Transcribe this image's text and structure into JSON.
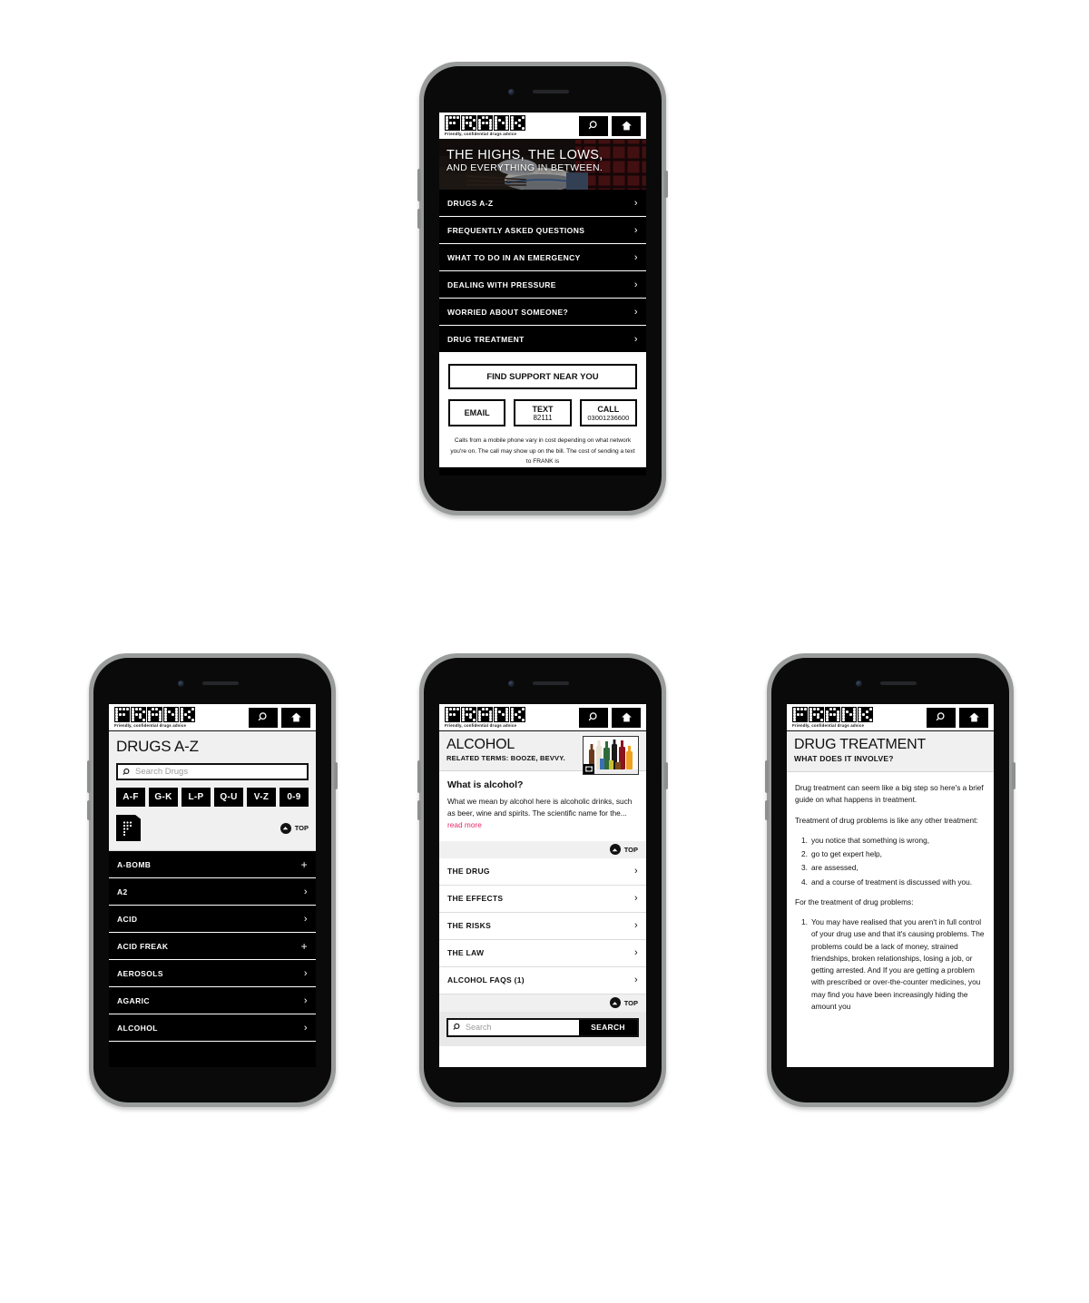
{
  "brand": {
    "name": "FRANK",
    "tagline": "Friendly, confidential drugs advice",
    "accent_pink": "#e8286e",
    "black": "#000000",
    "band_grey": "#f0f0f0"
  },
  "header": {
    "search_icon": "search-icon",
    "home_icon": "home-icon"
  },
  "phone_home": {
    "hero": {
      "line1": "THE HIGHS, THE LOWS,",
      "line2": "AND EVERYTHING IN BETWEEN."
    },
    "nav": [
      {
        "label": "DRUGS A-Z",
        "chevron": "›"
      },
      {
        "label": "FREQUENTLY ASKED QUESTIONS",
        "chevron": "›"
      },
      {
        "label": "WHAT TO DO IN AN EMERGENCY",
        "chevron": "›"
      },
      {
        "label": "DEALING WITH PRESSURE",
        "chevron": "›"
      },
      {
        "label": "WORRIED ABOUT SOMEONE?",
        "chevron": "›"
      },
      {
        "label": "DRUG TREATMENT",
        "chevron": "›"
      }
    ],
    "cta": {
      "find_support": "FIND SUPPORT NEAR YOU",
      "email": {
        "label": "EMAIL",
        "value": ""
      },
      "text": {
        "label": "TEXT",
        "value": "82111"
      },
      "call": {
        "label": "CALL",
        "value": "03001236600"
      },
      "note": "Calls from a mobile phone vary in cost depending on what network you're on. The call may show up on the bill. The cost of sending a text to FRANK is"
    }
  },
  "phone_az": {
    "title": "DRUGS A-Z",
    "search": {
      "placeholder": "Search Drugs",
      "value": ""
    },
    "chips": [
      "A-F",
      "G-K",
      "L-P",
      "Q-U",
      "V-Z",
      "0-9"
    ],
    "brand_tile": "frank-f-tile-icon",
    "top_label": "TOP",
    "drugs": [
      {
        "name": "A-BOMB",
        "marker": "+"
      },
      {
        "name": "A2",
        "marker": "›"
      },
      {
        "name": "ACID",
        "marker": "›"
      },
      {
        "name": "ACID FREAK",
        "marker": "+"
      },
      {
        "name": "AEROSOLS",
        "marker": "›"
      },
      {
        "name": "AGARIC",
        "marker": "›"
      },
      {
        "name": "ALCOHOL",
        "marker": "›"
      }
    ]
  },
  "phone_alcohol": {
    "title": "ALCOHOL",
    "subtitle": "RELATED TERMS: BOOZE, BEVVY.",
    "thumb_alt": "alcohol-bottles-thumbnail",
    "article": {
      "heading": "What is alcohol?",
      "body": "What we mean by alcohol here is alcoholic drinks, such as beer, wine and spirits. The scientific name for the...",
      "read_more": "read more"
    },
    "top_label": "TOP",
    "sections": [
      {
        "label": "THE DRUG",
        "chevron": "›"
      },
      {
        "label": "THE EFFECTS",
        "chevron": "›"
      },
      {
        "label": "THE RISKS",
        "chevron": "›"
      },
      {
        "label": "THE LAW",
        "chevron": "›"
      },
      {
        "label": "ALCOHOL FAQS (1)",
        "chevron": "›"
      }
    ],
    "search": {
      "placeholder": "Search",
      "value": "",
      "button": "SEARCH"
    }
  },
  "phone_treatment": {
    "title": "DRUG TREATMENT",
    "subtitle": "WHAT DOES IT INVOLVE?",
    "para1": "Drug treatment can seem like a big step so here's a brief guide on what happens in treatment.",
    "para2": "Treatment of drug problems is like any other treatment:",
    "list1": [
      {
        "num": "1.",
        "text": "you notice that something is wrong,"
      },
      {
        "num": "2.",
        "text": "go to get expert help,"
      },
      {
        "num": "3.",
        "text": "are assessed,"
      },
      {
        "num": "4.",
        "text": "and a course of treatment is discussed with you."
      }
    ],
    "para3": "For the treatment of drug problems:",
    "list2": [
      {
        "num": "1.",
        "text": "You may have realised that you aren't in full control of your drug use and that it's causing problems. The problems could be a lack of money, strained friendships, broken relationships, losing a job, or getting arrested.  And If you are getting a problem with prescribed or over-the-counter medicines, you may find you have been increasingly hiding the amount you"
      }
    ]
  }
}
